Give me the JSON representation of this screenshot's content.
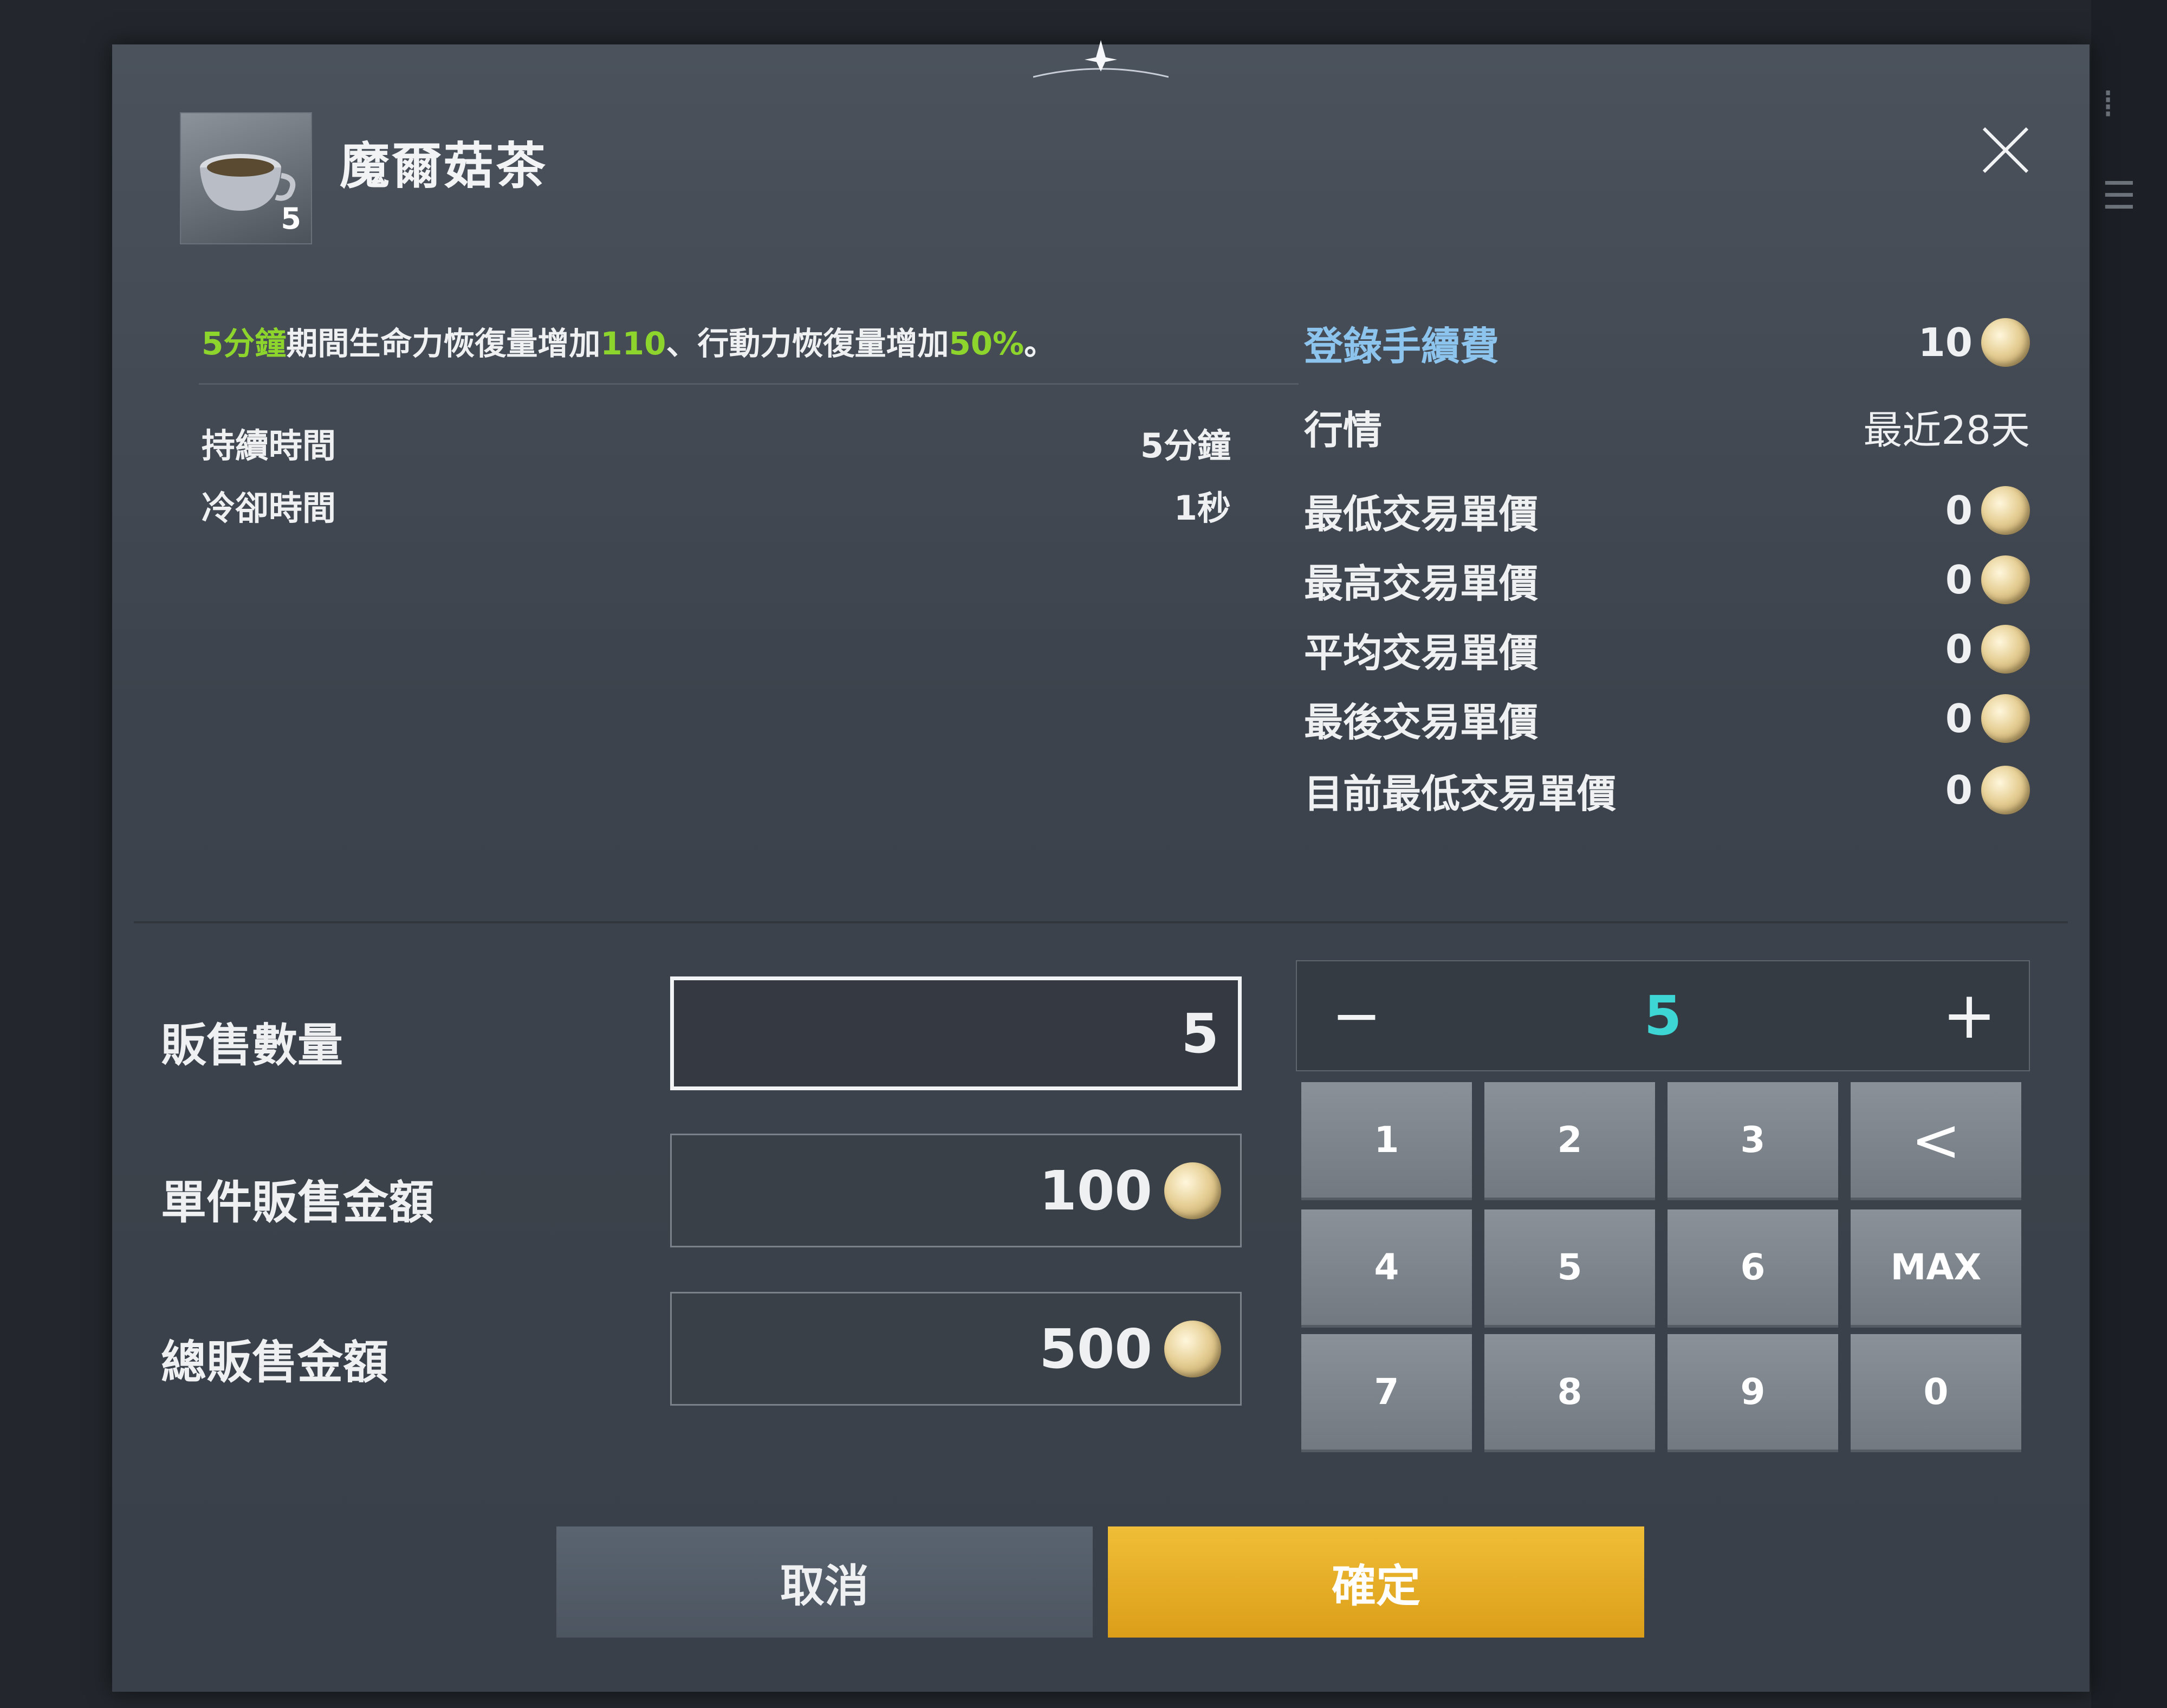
{
  "item": {
    "name": "魔爾菇茶",
    "count": "5",
    "description_parts": [
      {
        "text": "5分鐘",
        "color": "green"
      },
      {
        "text": "期間生命力恢復量增加",
        "color": "white"
      },
      {
        "text": "110",
        "color": "green"
      },
      {
        "text": "、行動力恢復量增加",
        "color": "white"
      },
      {
        "text": "50%",
        "color": "green"
      },
      {
        "text": "。",
        "color": "white"
      }
    ],
    "stats": [
      {
        "label": "持續時間",
        "value": "5分鐘"
      },
      {
        "label": "冷卻時間",
        "value": "1秒"
      }
    ]
  },
  "market": {
    "registration_fee": {
      "label": "登錄手續費",
      "value": "10"
    },
    "quotes": {
      "label": "行情",
      "value": "最近28天"
    },
    "rows": [
      {
        "label": "最低交易單價",
        "value": "0"
      },
      {
        "label": "最高交易單價",
        "value": "0"
      },
      {
        "label": "平均交易單價",
        "value": "0"
      },
      {
        "label": "最後交易單價",
        "value": "0"
      },
      {
        "label": "目前最低交易單價",
        "value": "0"
      }
    ]
  },
  "sell_form": {
    "quantity": {
      "label": "販售數量",
      "value": "5"
    },
    "unit_price": {
      "label": "單件販售金額",
      "value": "100"
    },
    "total": {
      "label": "總販售金額",
      "value": "500"
    }
  },
  "stepper": {
    "minus": "−",
    "value": "5",
    "plus": "+"
  },
  "keypad": [
    "1",
    "2",
    "3",
    "<",
    "4",
    "5",
    "6",
    "MAX",
    "7",
    "8",
    "9",
    "0"
  ],
  "buttons": {
    "cancel": "取消",
    "confirm": "確定"
  },
  "colors": {
    "accent_green": "#8dd42c",
    "accent_cyan": "#3ed6d4",
    "label_blue": "#8cc4ee",
    "confirm_gold": "#e8ae26"
  },
  "icons": {
    "close": "close-icon",
    "currency": "coin-icon",
    "item": "mushroom-tea-cup-icon"
  }
}
